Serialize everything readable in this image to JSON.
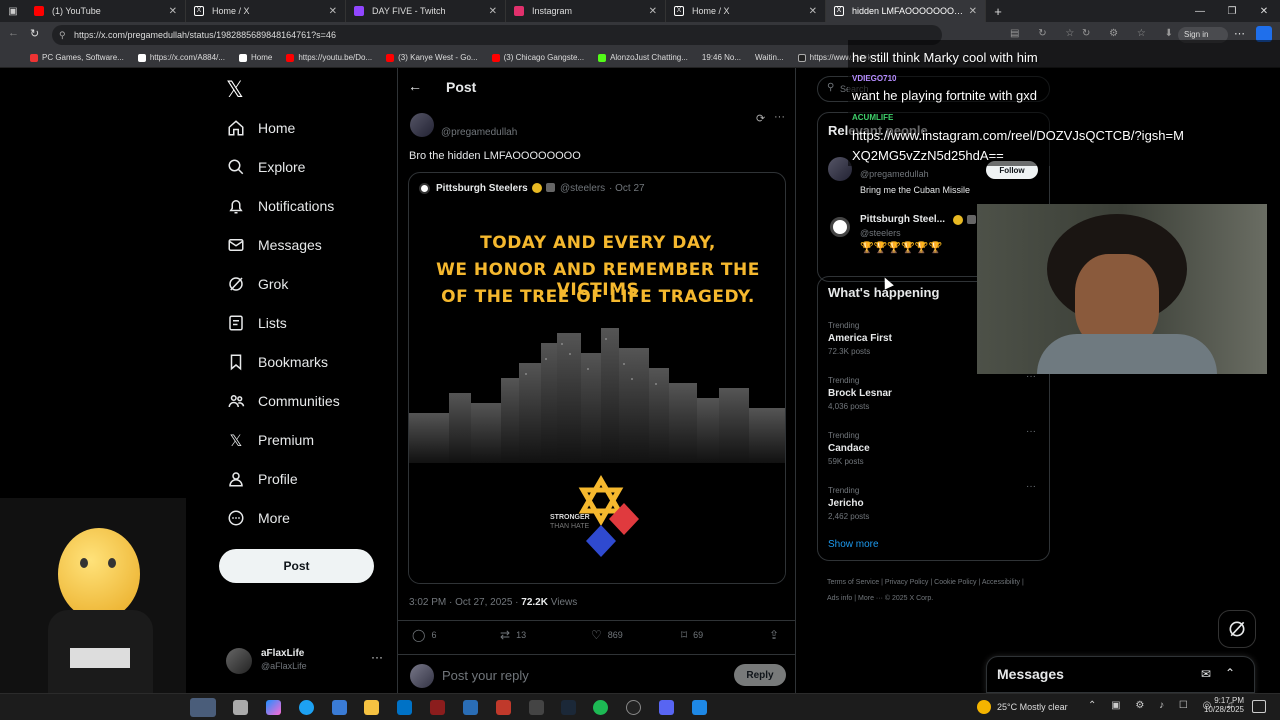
{
  "browser": {
    "tabs": [
      {
        "label": "(1) YouTube",
        "color": "#ff0000"
      },
      {
        "label": "Home / X",
        "color": "#000000"
      },
      {
        "label": "DAY FIVE - Twitch",
        "color": "#9146ff"
      },
      {
        "label": "Instagram",
        "color": "#e1306c"
      },
      {
        "label": "Home / X",
        "color": "#000000"
      },
      {
        "label": "hidden LMFAOOOOOOOO\" / X",
        "color": "#000000"
      }
    ],
    "url": "https://x.com/pregamedullah/status/1982885689848164761?s=46",
    "signin_label": "Sign in",
    "bookmarks": [
      "PC Games, Software...",
      "https://x.com/A884/...",
      "Home",
      "https://youtu.be/Do...",
      "(3) Kanye West - Go...",
      "(3) Chicago Gangste...",
      "AlonzoJust Chatting...",
      "19:46 No...",
      "Waitin...",
      "https://www.tiktok.c..."
    ]
  },
  "nav": {
    "items": [
      {
        "label": "Home",
        "icon": "home-icon"
      },
      {
        "label": "Explore",
        "icon": "search-icon"
      },
      {
        "label": "Notifications",
        "icon": "bell-icon"
      },
      {
        "label": "Messages",
        "icon": "envelope-icon"
      },
      {
        "label": "Grok",
        "icon": "grok-icon"
      },
      {
        "label": "Lists",
        "icon": "list-icon"
      },
      {
        "label": "Bookmarks",
        "icon": "bookmark-icon"
      },
      {
        "label": "Communities",
        "icon": "people-icon"
      },
      {
        "label": "Premium",
        "icon": "x-icon"
      },
      {
        "label": "Profile",
        "icon": "person-icon"
      },
      {
        "label": "More",
        "icon": "more-circle-icon"
      }
    ],
    "post_label": "Post",
    "account": {
      "name": "aFlaxLife",
      "handle": "@aFlaxLife"
    }
  },
  "main": {
    "header_title": "Post",
    "author_handle": "@pregamedullah",
    "tweet_text": "Bro the hidden LMFAOOOOOOOO",
    "quote": {
      "name": "Pittsburgh Steelers",
      "handle": "@steelers",
      "date": "· Oct 27",
      "headline": [
        "TODAY AND EVERY DAY,",
        "WE HONOR AND REMEMBER THE VICTIMS",
        "OF THE TREE OF LIFE TRAGEDY."
      ],
      "logo_text_1": "STRONGER",
      "logo_text_2": "THAN HATE"
    },
    "meta": {
      "time": "3:02 PM · Oct 27, 2025 ·",
      "views_count": "72.2K",
      "views_label": "Views"
    },
    "actions": {
      "replies": "6",
      "retweets": "13",
      "likes": "869",
      "bookmarks": "69"
    },
    "reply": {
      "placeholder": "Post your reply",
      "button": "Reply"
    }
  },
  "right": {
    "search_placeholder": "Search",
    "relevant_title": "Relevant people",
    "people": [
      {
        "handle": "@pregamedullah",
        "bio": "Bring me the Cuban Missile",
        "follow": "Follow"
      },
      {
        "name": "Pittsburgh Steel...",
        "handle": "@steelers",
        "bio": "🏆🏆🏆🏆🏆🏆"
      }
    ],
    "happening_title": "What's happening",
    "trends": [
      {
        "label": "Trending",
        "name": "America First",
        "count": "72.3K posts"
      },
      {
        "label": "Trending",
        "name": "Brock Lesnar",
        "count": "4,036 posts"
      },
      {
        "label": "Trending",
        "name": "Candace",
        "count": "59K posts"
      },
      {
        "label": "Trending",
        "name": "Jericho",
        "count": "2,462 posts"
      }
    ],
    "show_more": "Show more",
    "footer": [
      "Terms of Service",
      "Privacy Policy",
      "Cookie Policy",
      "Accessibility",
      "Ads info",
      "More ···",
      "© 2025 X Corp."
    ]
  },
  "chat": {
    "messages": [
      {
        "user": "",
        "text": "he still think Marky cool with him",
        "color": "#ff4d4d"
      },
      {
        "user": "VDIEGO710",
        "text": "want he playing fortnite with gxd",
        "color": "#b58cff"
      },
      {
        "user": "ACUMLIFE",
        "text": "https://www.instagram.com/reel/DOZVJsQCTCB/?igsh=MXQ2MG5vZzN5d25hdA==",
        "color": "#3fd16b"
      }
    ]
  },
  "messages_drawer": {
    "title": "Messages"
  },
  "taskbar": {
    "weather": "25°C  Mostly clear",
    "time": "9:17 PM",
    "date": "10/28/2025"
  }
}
